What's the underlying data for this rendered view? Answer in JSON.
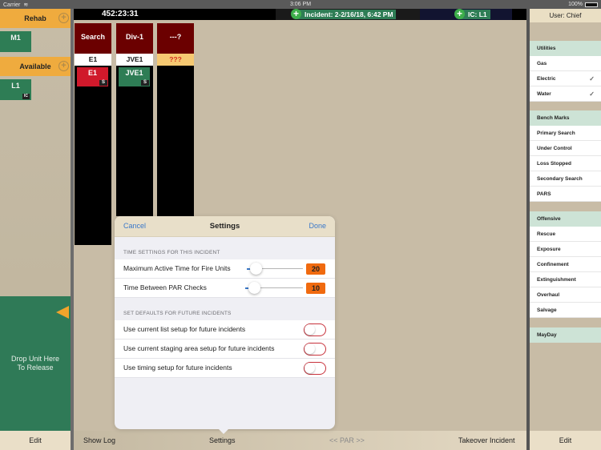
{
  "status_bar": {
    "carrier": "Carrier",
    "time": "3:06 PM",
    "battery": "100%"
  },
  "top_bar": {
    "elapsed_timer": "452:23:31",
    "incident": "Incident: 2-2/16/18, 6:42 PM",
    "incident_commander": "IC: L1"
  },
  "left_sidebar": {
    "groups": [
      {
        "label": "Rehab",
        "units": [
          {
            "name": "M1",
            "badge": ""
          }
        ]
      },
      {
        "label": "Available",
        "units": [
          {
            "name": "L1",
            "badge": "IC"
          }
        ]
      }
    ],
    "release_zone": {
      "line1": "Drop Unit Here",
      "line2": "To Release"
    },
    "edit_label": "Edit"
  },
  "divisions": [
    {
      "title": "Search",
      "assigned": "E1",
      "unit": {
        "name": "E1",
        "badge": "S",
        "color": "#d0192b"
      }
    },
    {
      "title": "Div-1",
      "assigned": "JVE1",
      "unit": {
        "name": "JVE1",
        "badge": "S",
        "color": "#2e7d55"
      }
    },
    {
      "title": "---?",
      "assigned": "???",
      "unit": null
    }
  ],
  "right_sidebar": {
    "user": "User: Chief",
    "sections": [
      {
        "title": "Utilities",
        "items": [
          {
            "label": "Gas",
            "checked": false
          },
          {
            "label": "Electric",
            "checked": true
          },
          {
            "label": "Water",
            "checked": true
          }
        ]
      },
      {
        "title": "Bench Marks",
        "items": [
          {
            "label": "Primary Search",
            "checked": false
          },
          {
            "label": "Under Control",
            "checked": false
          },
          {
            "label": "Loss Stopped",
            "checked": false
          },
          {
            "label": "Secondary Search",
            "checked": false
          },
          {
            "label": "PARS",
            "checked": false
          }
        ]
      },
      {
        "title": "Offensive",
        "items": [
          {
            "label": "Rescue",
            "checked": false
          },
          {
            "label": "Exposure",
            "checked": false
          },
          {
            "label": "Confinement",
            "checked": false
          },
          {
            "label": "Extinguishment",
            "checked": false
          },
          {
            "label": "Overhaul",
            "checked": false
          },
          {
            "label": "Salvage",
            "checked": false
          }
        ]
      },
      {
        "title": "MayDay",
        "items": []
      }
    ],
    "edit_label": "Edit",
    "check_glyph": "✓"
  },
  "settings_popover": {
    "cancel": "Cancel",
    "title": "Settings",
    "done": "Done",
    "time_section": "TIME SETTINGS FOR THIS INCIDENT",
    "max_active_time": {
      "label": "Maximum Active Time for Fire Units",
      "value": "20",
      "slider_fraction": 0.15
    },
    "par_interval": {
      "label": "Time Between PAR Checks",
      "value": "10",
      "slider_fraction": 0.15
    },
    "defaults_section": "SET DEFAULTS FOR FUTURE INCIDENTS",
    "toggles": [
      {
        "label": "Use current list setup for future incidents",
        "on": false
      },
      {
        "label": "Use current staging area setup for future incidents",
        "on": false
      },
      {
        "label": "Use timing setup for future incidents",
        "on": false
      }
    ]
  },
  "toolbar": {
    "show_log": "Show Log",
    "settings": "Settings",
    "par": "<< PAR >>",
    "takeover": "Takeover Incident"
  },
  "colors": {
    "accent_blue": "#3a78c9",
    "orange": "#efab3e",
    "unit_green": "#2e7d55",
    "division_red": "#6b0000",
    "value_orange": "#f06a0f"
  }
}
